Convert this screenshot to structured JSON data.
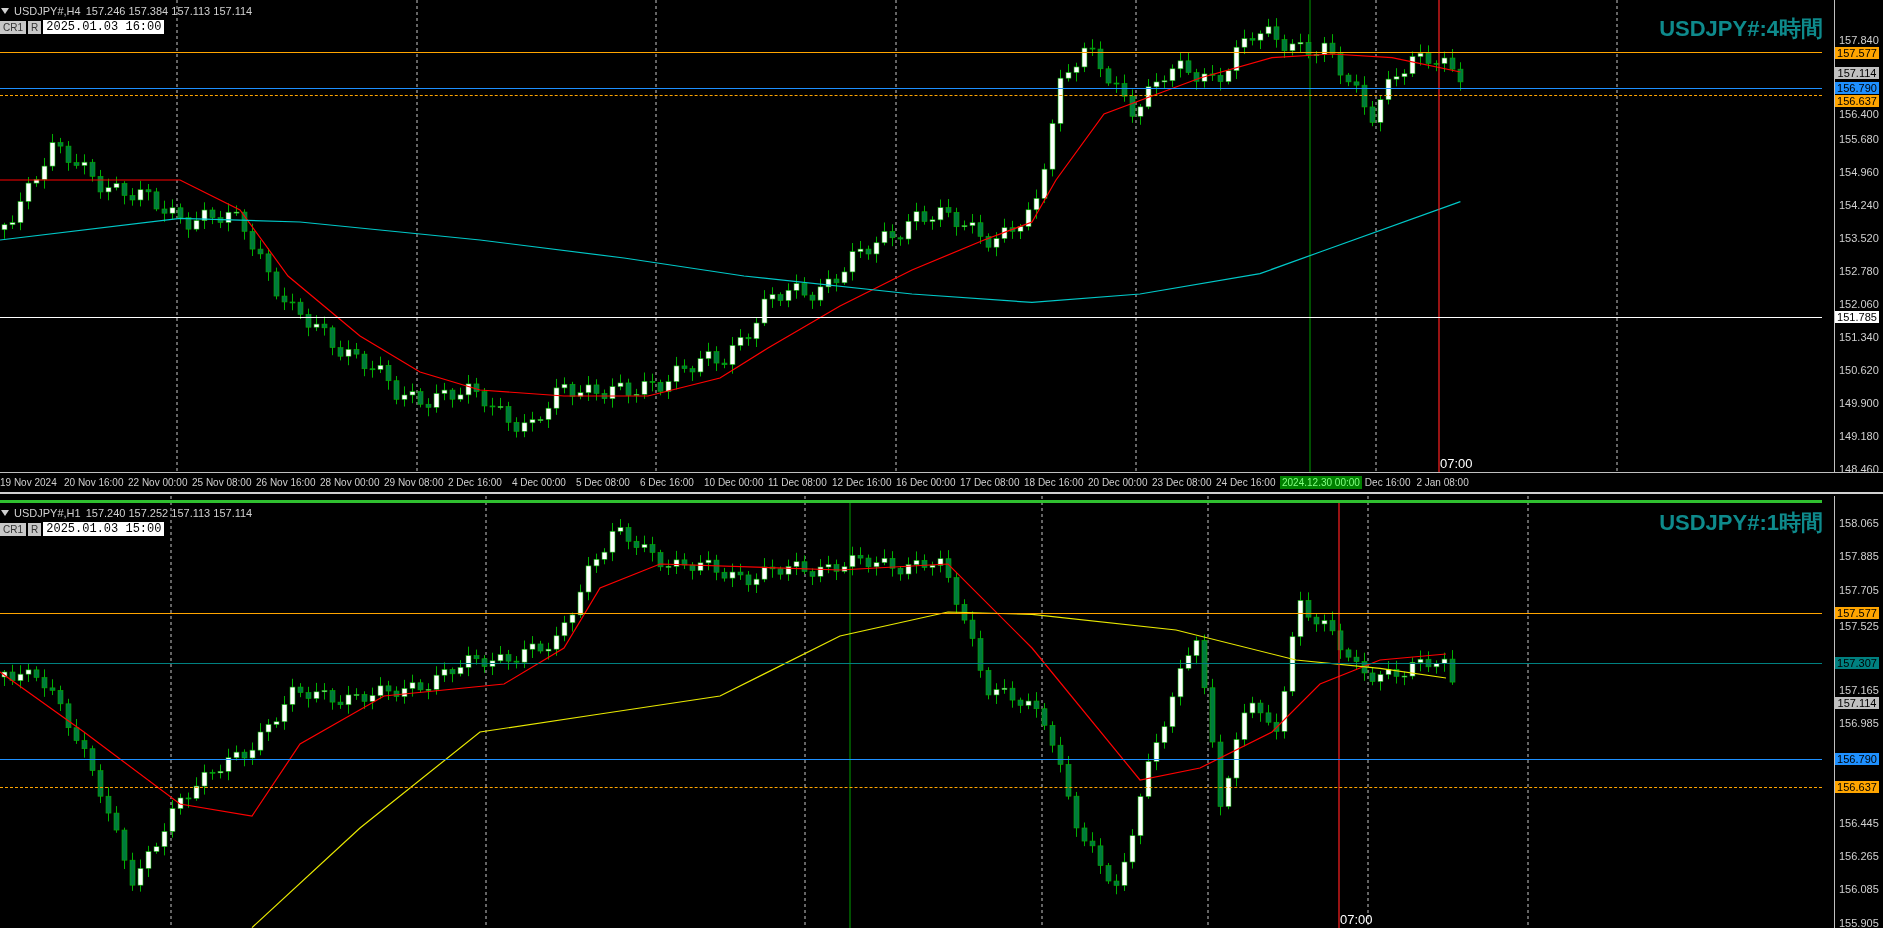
{
  "charts": [
    {
      "symbol": "USDJPY#,H4",
      "ohlc": "157.246 157.384 157.113 157.114",
      "buttons": [
        "CR1",
        "R"
      ],
      "datetime": "2025.01.03 16:00",
      "title": "USDJPY#:4時間",
      "price_ticks": [
        "157.840",
        "156.400",
        "155.680",
        "154.960",
        "154.240",
        "153.520",
        "152.780",
        "152.060",
        "151.340",
        "150.620",
        "149.900",
        "149.180",
        "148.460"
      ],
      "price_tags": [
        {
          "price": "157.577",
          "color": "#ffa500",
          "line": true,
          "dashed": false
        },
        {
          "price": "157.114",
          "color": "#c0c0c0",
          "line": false
        },
        {
          "price": "156.790",
          "color": "#1e90ff",
          "line": true,
          "dashed": false
        },
        {
          "price": "156.637",
          "color": "#ffa500",
          "line": true,
          "dashed": true
        },
        {
          "price": "151.785",
          "color": "#ffffff",
          "line": true,
          "dashed": false
        }
      ],
      "time_axis": [
        {
          "label": "19 Nov 2024",
          "highlighted": false
        },
        {
          "label": "20 Nov 16:00",
          "highlighted": false
        },
        {
          "label": "22 Nov 00:00",
          "highlighted": false
        },
        {
          "label": "25 Nov 08:00",
          "highlighted": false
        },
        {
          "label": "26 Nov 16:00",
          "highlighted": false
        },
        {
          "label": "28 Nov 00:00",
          "highlighted": false
        },
        {
          "label": "29 Nov 08:00",
          "highlighted": false
        },
        {
          "label": "2 Dec 16:00",
          "highlighted": false
        },
        {
          "label": "4 Dec 00:00",
          "highlighted": false
        },
        {
          "label": "5 Dec 08:00",
          "highlighted": false
        },
        {
          "label": "6 Dec 16:00",
          "highlighted": false
        },
        {
          "label": "10 Dec 00:00",
          "highlighted": false
        },
        {
          "label": "11 Dec 08:00",
          "highlighted": false
        },
        {
          "label": "12 Dec 16:00",
          "highlighted": false
        },
        {
          "label": "16 Dec 00:00",
          "highlighted": false
        },
        {
          "label": "17 Dec 08:00",
          "highlighted": false
        },
        {
          "label": "18 Dec 16:00",
          "highlighted": false
        },
        {
          "label": "20 Dec 00:00",
          "highlighted": false
        },
        {
          "label": "23 Dec 08:00",
          "highlighted": false
        },
        {
          "label": "24 Dec 16:00",
          "highlighted": false
        },
        {
          "label": "2024.12.30 00:00",
          "highlighted": true
        },
        {
          "label": "Dec 16:00",
          "highlighted": false
        },
        {
          "label": "2 Jan 08:00",
          "highlighted": false
        }
      ],
      "vline_label": "07:00"
    },
    {
      "symbol": "USDJPY#,H1",
      "ohlc": "157.240 157.252 157.113 157.114",
      "buttons": [
        "CR1",
        "R"
      ],
      "datetime": "2025.01.03 15:00",
      "title": "USDJPY#:1時間",
      "price_ticks": [
        "158.065",
        "157.885",
        "157.705",
        "157.525",
        "157.165",
        "156.985",
        "156.445",
        "156.265",
        "156.085",
        "155.905"
      ],
      "price_tags": [
        {
          "price": "157.577",
          "color": "#ffa500",
          "line": true,
          "dashed": false
        },
        {
          "price": "157.307",
          "color": "#008080",
          "line": true,
          "dashed": false
        },
        {
          "price": "157.114",
          "color": "#c0c0c0",
          "line": false
        },
        {
          "price": "156.790",
          "color": "#1e90ff",
          "line": true,
          "dashed": false
        },
        {
          "price": "156.637",
          "color": "#ffa500",
          "line": true,
          "dashed": true
        }
      ],
      "vline_label": "07:00"
    }
  ]
}
